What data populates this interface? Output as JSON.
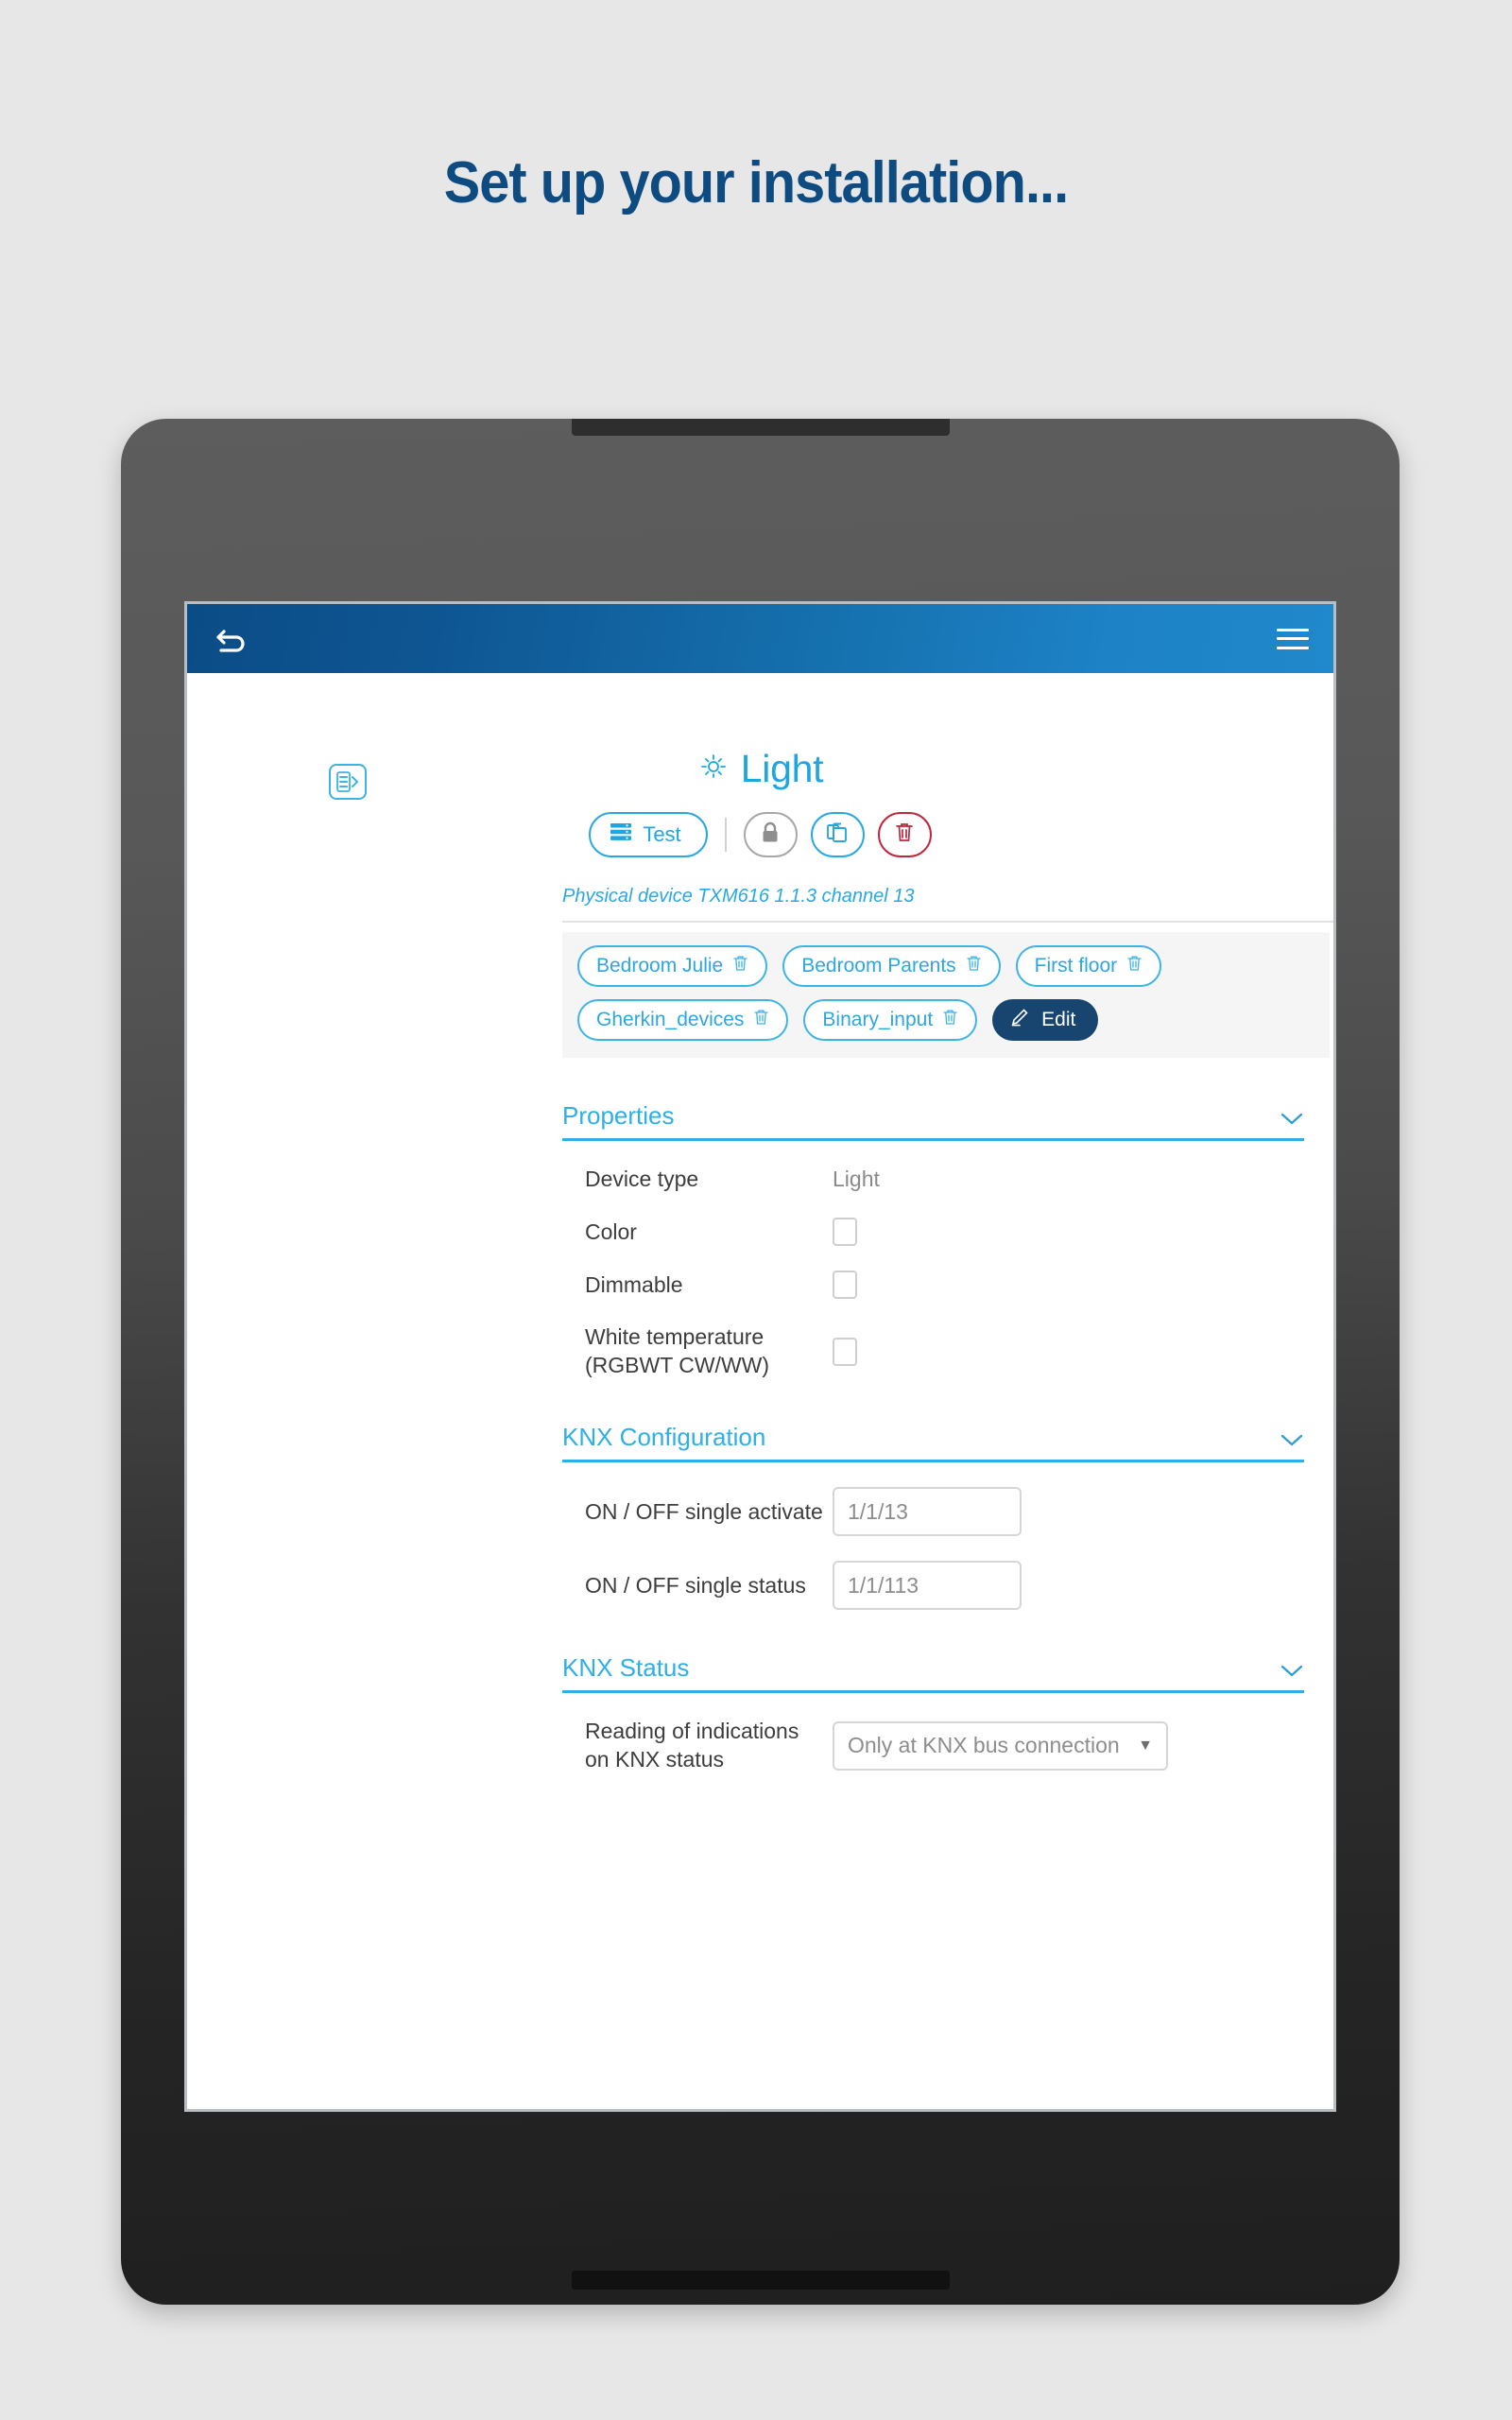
{
  "page": {
    "heading": "Set up your installation..."
  },
  "app": {
    "header": {
      "back_icon": "back-arrow-icon",
      "menu_icon": "hamburger-menu-icon"
    },
    "panel_toggle_icon": "list-expand-icon",
    "device": {
      "icon": "light-sun-icon",
      "title": "Light"
    },
    "actions": {
      "test_label": "Test",
      "test_icon": "list-lines-icon",
      "lock_icon": "lock-icon",
      "duplicate_icon": "copy-icon",
      "delete_icon": "trash-icon"
    },
    "physical_device": "Physical device TXM616 1.1.3 channel 13",
    "tags": [
      {
        "label": "Bedroom Julie",
        "delete_icon": "trash-icon"
      },
      {
        "label": "Bedroom Parents",
        "delete_icon": "trash-icon"
      },
      {
        "label": "First floor",
        "delete_icon": "trash-icon"
      },
      {
        "label": "Gherkin_devices",
        "delete_icon": "trash-icon"
      },
      {
        "label": "Binary_input",
        "delete_icon": "trash-icon"
      }
    ],
    "edit_button": {
      "label": "Edit",
      "icon": "pencil-icon"
    },
    "sections": {
      "properties": {
        "title": "Properties",
        "chevron": "chevron-down-icon",
        "device_type_label": "Device type",
        "device_type_value": "Light",
        "color_label": "Color",
        "color_checked": false,
        "dimmable_label": "Dimmable",
        "dimmable_checked": false,
        "white_temperature_label": "White temperature (RGBWT CW/WW)",
        "white_temperature_checked": false
      },
      "knx_configuration": {
        "title": "KNX Configuration",
        "chevron": "chevron-down-icon",
        "on_off_activate_label": "ON / OFF single activate",
        "on_off_activate_value": "1/1/13",
        "on_off_status_label": "ON / OFF single status",
        "on_off_status_value": "1/1/113"
      },
      "knx_status": {
        "title": "KNX Status",
        "chevron": "chevron-down-icon",
        "reading_label": "Reading of indications on KNX status",
        "reading_value": "Only at KNX bus connection",
        "caret": "▼"
      }
    }
  },
  "colors": {
    "brand_blue": "#2eafe6",
    "header_dark": "#0b4c86",
    "header_light": "#2088cc",
    "heading_navy": "#0e4b81",
    "edit_navy": "#17456f",
    "delete_red": "#c2263d",
    "page_bg": "#e7e7e7"
  }
}
